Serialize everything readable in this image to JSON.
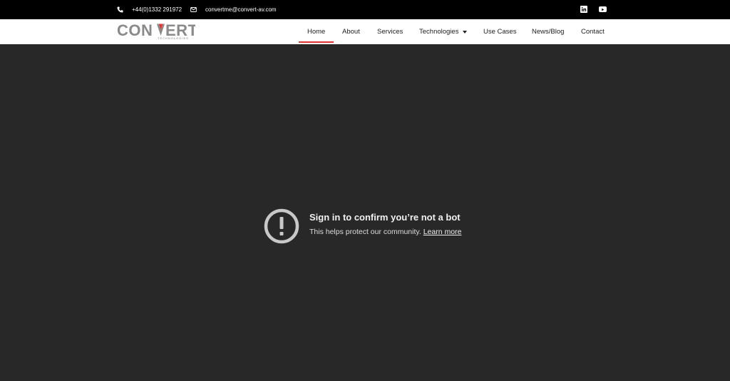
{
  "topbar": {
    "phone": "+44(0)1332 291972",
    "email": "convertme@convert-av.com",
    "social": [
      "linkedin-icon",
      "youtube-icon"
    ]
  },
  "logo": {
    "word": "CONVERT",
    "sub": "TECHNOLOGIES",
    "accent": "#d33"
  },
  "nav": {
    "items": [
      {
        "label": "Home"
      },
      {
        "label": "About"
      },
      {
        "label": "Services"
      },
      {
        "label": "Technologies"
      },
      {
        "label": "Use Cases"
      },
      {
        "label": "News/Blog"
      },
      {
        "label": "Contact"
      }
    ],
    "active": "Home"
  },
  "notice": {
    "title": "Sign in to confirm you’re not a bot",
    "body": "This helps protect our community.",
    "link": "Learn more",
    "icon": "alert-icon"
  },
  "colors": {
    "topbar": "#000000",
    "background": "#282828",
    "active_underline": "#dd3333"
  }
}
